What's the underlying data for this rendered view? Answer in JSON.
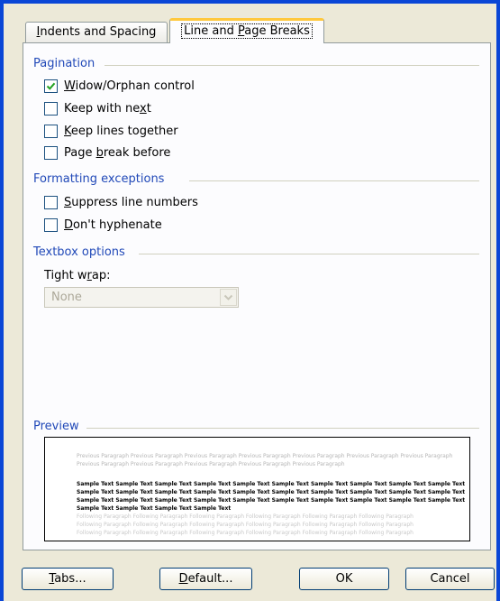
{
  "tabs": [
    {
      "pre": "",
      "ul": "I",
      "post": "ndents and Spacing"
    },
    {
      "pre": "Line and ",
      "ul": "P",
      "post": "age Breaks"
    }
  ],
  "pagination": {
    "title": "Pagination",
    "options": [
      {
        "pre": "",
        "ul": "W",
        "post": "idow/Orphan control",
        "checked": true
      },
      {
        "pre": "Keep with ne",
        "ul": "x",
        "post": "t",
        "checked": false
      },
      {
        "pre": "",
        "ul": "K",
        "post": "eep lines together",
        "checked": false
      },
      {
        "pre": "Page ",
        "ul": "b",
        "post": "reak before",
        "checked": false
      }
    ]
  },
  "formatting": {
    "title": "Formatting exceptions",
    "options": [
      {
        "pre": "",
        "ul": "S",
        "post": "uppress line numbers",
        "checked": false
      },
      {
        "pre": "",
        "ul": "D",
        "post": "on't hyphenate",
        "checked": false
      }
    ]
  },
  "textbox": {
    "title": "Textbox options",
    "tight_wrap": {
      "pre": "Tight w",
      "ul": "r",
      "post": "ap:"
    },
    "select_value": "None"
  },
  "preview": {
    "title": "Preview",
    "previous": [
      "Previous Paragraph Previous Paragraph Previous Paragraph Previous Paragraph Previous Paragraph Previous Paragraph Previous Paragraph",
      "Previous Paragraph Previous Paragraph Previous Paragraph Previous Paragraph Previous Paragraph"
    ],
    "sample": [
      "Sample Text Sample Text Sample Text Sample Text Sample Text Sample Text Sample Text Sample Text Sample Text Sample Text",
      "Sample Text Sample Text Sample Text Sample Text Sample Text Sample Text Sample Text Sample Text Sample Text Sample Text",
      "Sample Text Sample Text Sample Text Sample Text Sample Text Sample Text Sample Text Sample Text Sample Text Sample Text",
      "Sample Text Sample Text Sample Text Sample Text"
    ],
    "following": [
      "Following Paragraph Following Paragraph Following Paragraph Following Paragraph Following Paragraph Following Paragraph",
      "Following Paragraph Following Paragraph Following Paragraph Following Paragraph Following Paragraph Following Paragraph",
      "Following Paragraph Following Paragraph Following Paragraph Following Paragraph Following Paragraph Following Paragraph"
    ]
  },
  "buttons": {
    "tabs": {
      "pre": "",
      "ul": "T",
      "post": "abs..."
    },
    "default": {
      "pre": "",
      "ul": "D",
      "post": "efault..."
    },
    "ok": "OK",
    "cancel": "Cancel"
  },
  "colors": {
    "group_title": "#2149b8",
    "checkmark": "#21a121",
    "window_frame": "#0a46d6",
    "dialog_bg": "#ece9d8"
  }
}
